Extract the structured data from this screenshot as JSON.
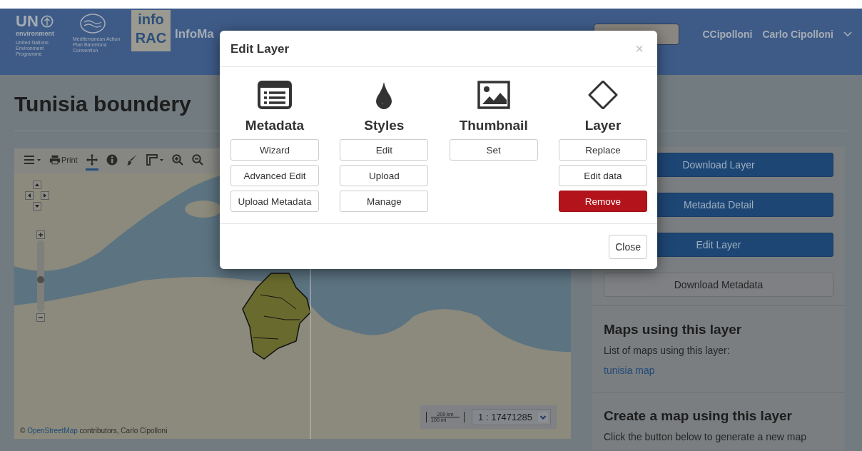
{
  "header": {
    "un_logo": {
      "mark": "UN",
      "word": "environment",
      "caption": "United Nations Environment Programme"
    },
    "map_logo": {
      "caption": "Mediterranean Action Plan Barcelona Convention"
    },
    "rac_logo": {
      "top": "info",
      "bottom": "RAC"
    },
    "site_name": "InfoMa",
    "username": "CCipolloni",
    "full_name": "Carlo Cipolloni"
  },
  "page": {
    "title": "Tunisia boundery"
  },
  "map": {
    "tools": [
      {
        "kind": "menu",
        "selected": false
      },
      {
        "kind": "print",
        "label": "Print",
        "selected": false
      },
      {
        "kind": "pan",
        "selected": true
      },
      {
        "kind": "info",
        "selected": false
      },
      {
        "kind": "brush",
        "selected": false
      },
      {
        "kind": "measure",
        "selected": false
      },
      {
        "kind": "zoom-in",
        "selected": false
      },
      {
        "kind": "zoom-out",
        "selected": false
      }
    ],
    "zoom_slider": {
      "level": 0.4
    },
    "scale": {
      "metric": "200 km",
      "imperial": "100 mi",
      "ratio": "1 : 17471285"
    },
    "attribution": {
      "prefix": "©",
      "link": "OpenStreetMap",
      "rest": "contributors, Carlo Cipolloni"
    }
  },
  "sidebar": {
    "buttons": [
      {
        "label": "Download Layer",
        "kind": "primary"
      },
      {
        "label": "Metadata Detail",
        "kind": "primary"
      },
      {
        "label": "Edit Layer",
        "kind": "primary"
      },
      {
        "label": "Download Metadata",
        "kind": "default"
      }
    ],
    "maps_section": {
      "title": "Maps using this layer",
      "text": "List of maps using this layer:",
      "links": [
        "tunisia map"
      ]
    },
    "create_section": {
      "title": "Create a map using this layer",
      "text": "Click the button below to generate a new map"
    }
  },
  "modal": {
    "title": "Edit Layer",
    "close_symbol": "×",
    "columns": [
      {
        "kind": "list",
        "title": "Metadata",
        "buttons": [
          {
            "label": "Wizard",
            "kind": "default"
          },
          {
            "label": "Advanced Edit",
            "kind": "default"
          },
          {
            "label": "Upload Metadata",
            "kind": "default"
          }
        ]
      },
      {
        "kind": "drop",
        "title": "Styles",
        "buttons": [
          {
            "label": "Edit",
            "kind": "default"
          },
          {
            "label": "Upload",
            "kind": "default"
          },
          {
            "label": "Manage",
            "kind": "default"
          }
        ]
      },
      {
        "kind": "image",
        "title": "Thumbnail",
        "buttons": [
          {
            "label": "Set",
            "kind": "default"
          }
        ]
      },
      {
        "kind": "diamond",
        "title": "Layer",
        "buttons": [
          {
            "label": "Replace",
            "kind": "default"
          },
          {
            "label": "Edit data",
            "kind": "default"
          },
          {
            "label": "Remove",
            "kind": "danger"
          }
        ]
      }
    ],
    "footer_button": "Close"
  }
}
